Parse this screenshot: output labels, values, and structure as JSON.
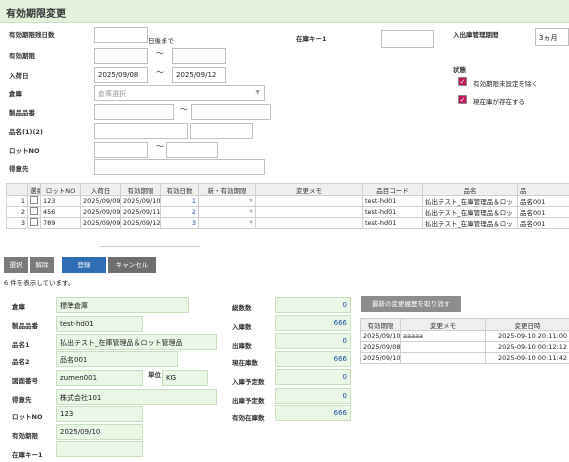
{
  "page_title": "有効期限変更",
  "search": {
    "days_label": "有効期限残日数",
    "days_suffix": "日後まで",
    "expiry_label": "有効期限",
    "arrival_label": "入荷日",
    "arrival_from": "2025/09/08",
    "arrival_to": "2025/09/12",
    "warehouse_label": "倉庫",
    "warehouse_placeholder": "倉庫選択",
    "product_code_label": "製品品番",
    "product_name_label": "品名(1)(2)",
    "lot_label": "ロットNO",
    "customer_label": "得意先",
    "stock_key_label": "在庫キー1",
    "period_label": "入出庫管理期間",
    "period_value": "3ヵ月",
    "status_label": "状態",
    "status_opt1": "有効期限未設定を除く",
    "status_opt2": "現在庫が存在する",
    "tilde": "～"
  },
  "grid": {
    "headers": [
      "",
      "選択",
      "ロットNO",
      "入荷日",
      "有効期限",
      "有効日数",
      "新・有効期限",
      "変更メモ",
      "品目コード",
      "品名",
      "品"
    ],
    "rows": [
      {
        "no": "1",
        "lot": "123",
        "arrival": "2025/09/09",
        "expiry": "2025/09/10",
        "days": "1",
        "code": "test-hd01",
        "name": "払出テスト_在庫管理品＆ロッ",
        "name2": "品名001"
      },
      {
        "no": "2",
        "lot": "456",
        "arrival": "2025/09/09",
        "expiry": "2025/09/11",
        "days": "2",
        "code": "test-hd01",
        "name": "払出テスト_在庫管理品＆ロッ",
        "name2": "品名001"
      },
      {
        "no": "3",
        "lot": "789",
        "arrival": "2025/09/09",
        "expiry": "2025/09/12",
        "days": "3",
        "code": "test-hd01",
        "name": "払出テスト_在庫管理品＆ロッ",
        "name2": "品名001"
      }
    ]
  },
  "buttons": {
    "select": "選択",
    "release": "解除",
    "register": "登録",
    "cancel": "キャンセル"
  },
  "count_text": "6 件を表示しています。",
  "detail": {
    "warehouse_label": "倉庫",
    "warehouse_value": "標準倉庫",
    "product_code_label": "製品品番",
    "product_code_value": "test-hd01",
    "name1_label": "品名1",
    "name1_value": "払出テスト_在庫管理品＆ロット管理品",
    "name2_label": "品名2",
    "name2_value": "品名001",
    "drawing_label": "図面番号",
    "drawing_value": "zumen001",
    "unit_label": "単位",
    "unit_value": "KG",
    "customer_label": "得意先",
    "customer_value": "株式会社101",
    "lot_label": "ロットNO",
    "lot_value": "123",
    "expiry_label": "有効期限",
    "expiry_value": "2025/09/10",
    "stock_key_label": "在庫キー1",
    "stock_key_value": ""
  },
  "totals": {
    "total_label": "総数数",
    "total_value": "0",
    "in_label": "入庫数",
    "in_value": "666",
    "out_label": "出庫数",
    "out_value": "0",
    "current_label": "現在庫数",
    "current_value": "666",
    "planned_in_label": "入庫予定数",
    "planned_in_value": "0",
    "planned_out_label": "出庫予定数",
    "planned_out_value": "0",
    "valid_label": "有効在庫数",
    "valid_value": "666"
  },
  "history": {
    "cancel_button": "最新の変更履歴を取り消す",
    "headers": [
      "有効期限",
      "変更メモ",
      "変更日時"
    ],
    "rows": [
      {
        "expiry": "2025/09/10",
        "memo": "aaaaa",
        "datetime": "2025-09-10 20:11:00"
      },
      {
        "expiry": "2025/09/08",
        "memo": "",
        "datetime": "2025-09-10 00:12:12"
      },
      {
        "expiry": "2025/09/10",
        "memo": "",
        "datetime": "2025-09-10 00:11:42"
      }
    ]
  },
  "colors": {
    "accent_green": "#e3f2dc",
    "button_blue": "#2f6db5",
    "checkbox_magenta": "#c2185b"
  }
}
